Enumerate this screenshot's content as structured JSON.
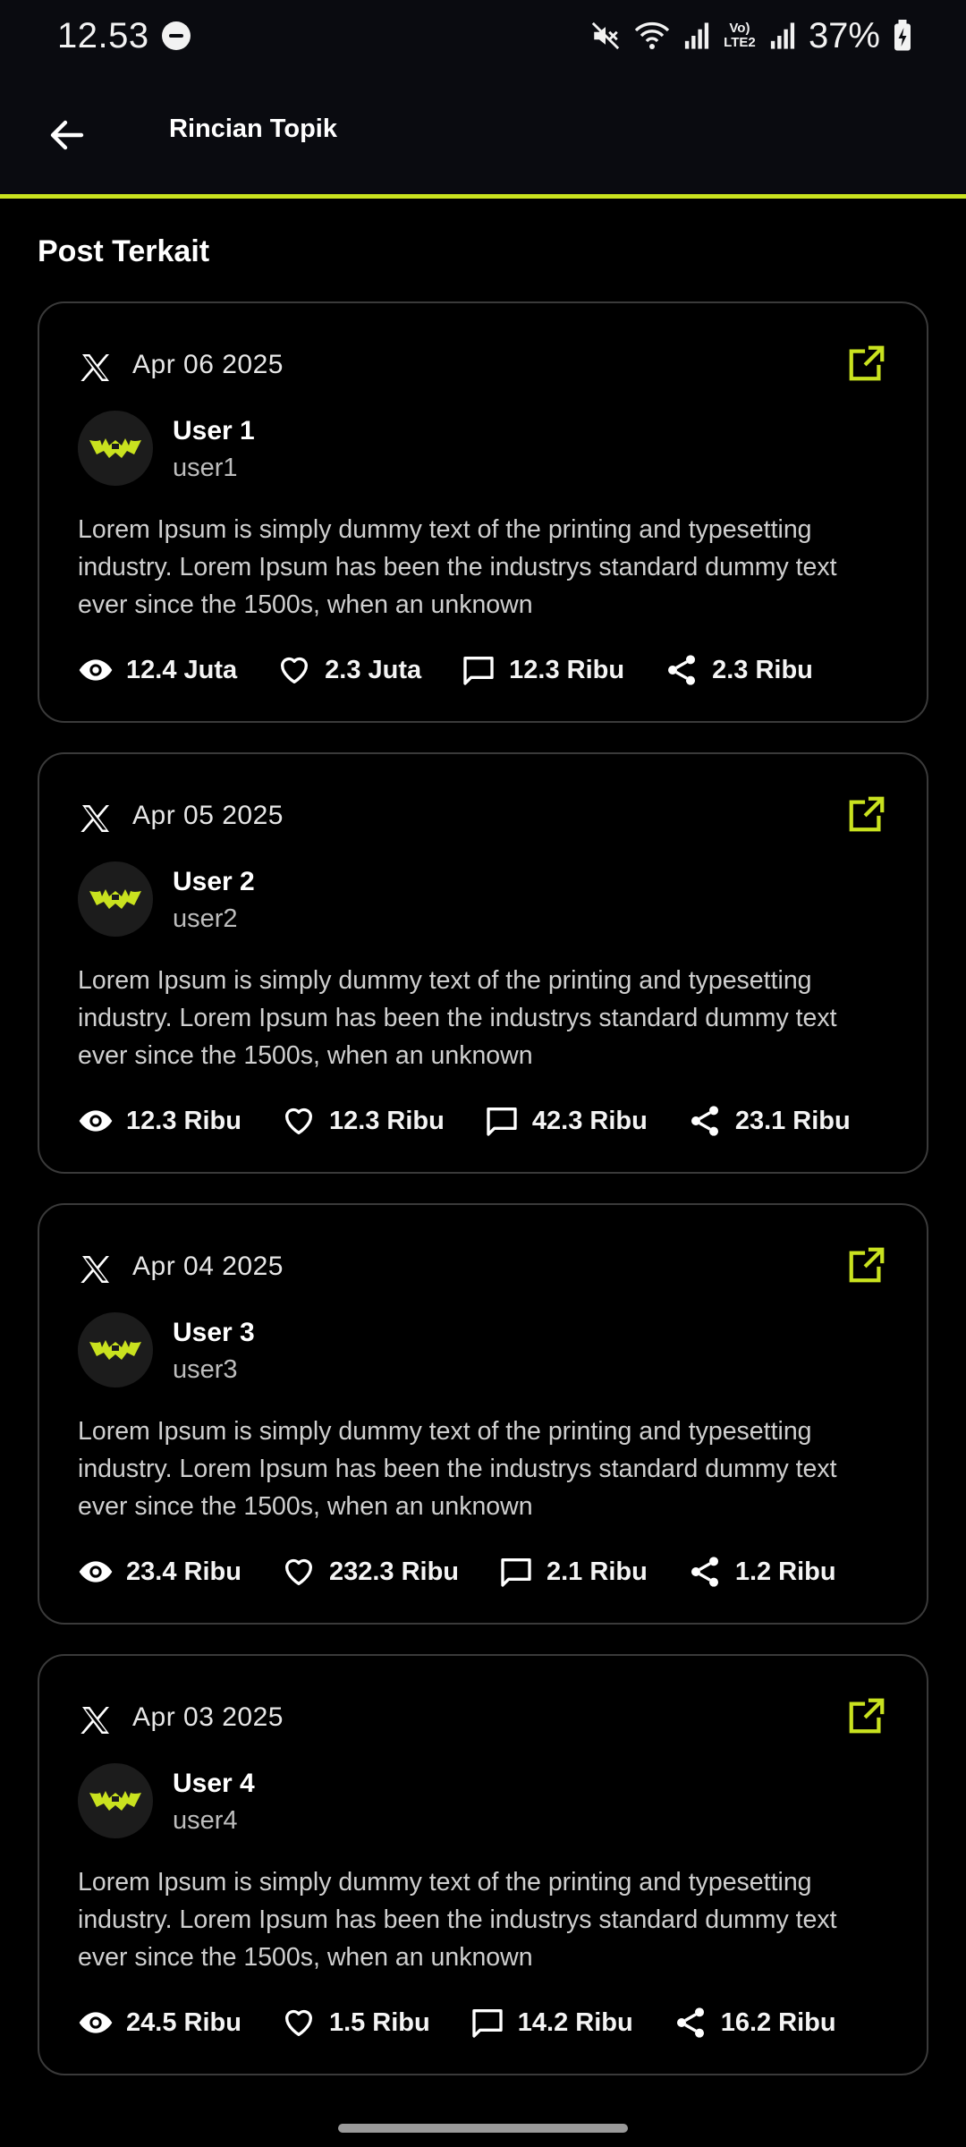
{
  "status_bar": {
    "time": "12.53",
    "network_label": "Vo) LTE2",
    "battery": "37%"
  },
  "header": {
    "title": "Rincian Topik"
  },
  "section": {
    "title": "Post Terkait"
  },
  "colors": {
    "accent": "#c9e21f",
    "background": "#000000",
    "card_border": "#3a3a3a"
  },
  "icons": {
    "back": "arrow-left-icon",
    "platform": "x-logo-icon",
    "open": "external-link-icon",
    "views": "eye-icon",
    "likes": "heart-icon",
    "comments": "comment-icon",
    "shares": "share-icon"
  },
  "posts": [
    {
      "date": "Apr 06 2025",
      "name": "User 1",
      "handle": "user1",
      "text": "Lorem Ipsum is simply dummy text of the printing and typesetting industry. Lorem Ipsum has been the industrys standard dummy text ever since the 1500s, when an unknown",
      "views": "12.4 Juta",
      "likes": "2.3 Juta",
      "comments": "12.3 Ribu",
      "shares": "2.3 Ribu"
    },
    {
      "date": "Apr 05 2025",
      "name": "User 2",
      "handle": "user2",
      "text": "Lorem Ipsum is simply dummy text of the printing and typesetting industry. Lorem Ipsum has been the industrys standard dummy text ever since the 1500s, when an unknown",
      "views": "12.3 Ribu",
      "likes": "12.3 Ribu",
      "comments": "42.3 Ribu",
      "shares": "23.1 Ribu"
    },
    {
      "date": "Apr 04 2025",
      "name": "User 3",
      "handle": "user3",
      "text": "Lorem Ipsum is simply dummy text of the printing and typesetting industry. Lorem Ipsum has been the industrys standard dummy text ever since the 1500s, when an unknown",
      "views": "23.4 Ribu",
      "likes": "232.3 Ribu",
      "comments": "2.1 Ribu",
      "shares": "1.2 Ribu"
    },
    {
      "date": "Apr 03 2025",
      "name": "User 4",
      "handle": "user4",
      "text": "Lorem Ipsum is simply dummy text of the printing and typesetting industry. Lorem Ipsum has been the industrys standard dummy text ever since the 1500s, when an unknown",
      "views": "24.5 Ribu",
      "likes": "1.5 Ribu",
      "comments": "14.2 Ribu",
      "shares": "16.2 Ribu"
    }
  ]
}
